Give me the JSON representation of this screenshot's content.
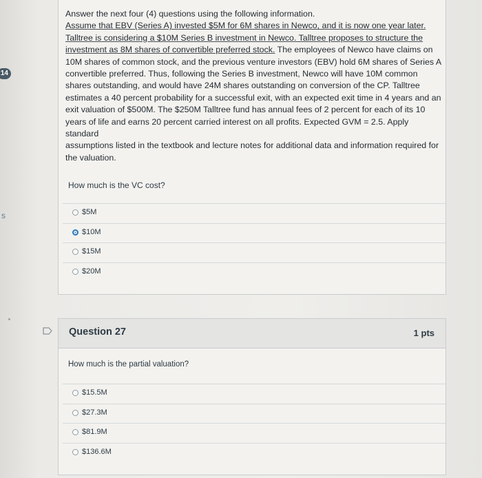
{
  "sidebar": {
    "question_marker": "14",
    "cut_text": "s"
  },
  "question26": {
    "intro_lines": [
      {
        "text": "Answer the next four (4) questions using the following information.",
        "underline": false
      },
      {
        "text": "Assume that EBV (Series A) invested $5M for 6M shares in Newco, and it is now one year later.",
        "underline": true
      },
      {
        "text": "Talltree is considering a $10M Series B investment in Newco. Talltree proposes to structure the",
        "underline": true
      },
      {
        "text_underlined": "investment as 8M shares of convertible preferred stock.",
        "text_rest": " The employees of Newco have claims on"
      },
      {
        "text": "10M shares of common stock, and the previous venture investors (EBV) hold 6M shares of Series A",
        "underline": false
      },
      {
        "text": "convertible preferred. Thus, following the Series B investment, Newco will have 10M common",
        "underline": false
      },
      {
        "text": "shares outstanding, and would have 24M shares outstanding on conversion of the CP. Talltree",
        "underline": false
      },
      {
        "text": "estimates a 40 percent probability for a successful exit, with an expected exit time in 4 years and an",
        "underline": false
      },
      {
        "text": "exit valuation of $500M. The $250M Talltree fund has annual fees of 2 percent for each of its 10",
        "underline": false
      },
      {
        "text": "years of life and earns 20 percent carried interest on all profits. Expected GVM = 2.5. Apply standard",
        "underline": false
      },
      {
        "text": "assumptions listed in the textbook and lecture notes for additional data and information required for",
        "underline": false
      },
      {
        "text": "the valuation.",
        "underline": false
      }
    ],
    "prompt": "How much is the VC cost?",
    "options": [
      "$5M",
      "$10M",
      "$15M",
      "$20M"
    ],
    "selected_index": 1
  },
  "question27": {
    "title": "Question 27",
    "points": "1 pts",
    "prompt": "How much is the partial valuation?",
    "options": [
      "$15.5M",
      "$27.3M",
      "$81.9M",
      "$136.6M"
    ],
    "selected_index": null
  },
  "colors": {
    "accent": "#2b7abc",
    "text": "#2d3b45",
    "header_bg": "#e4e4e2"
  }
}
